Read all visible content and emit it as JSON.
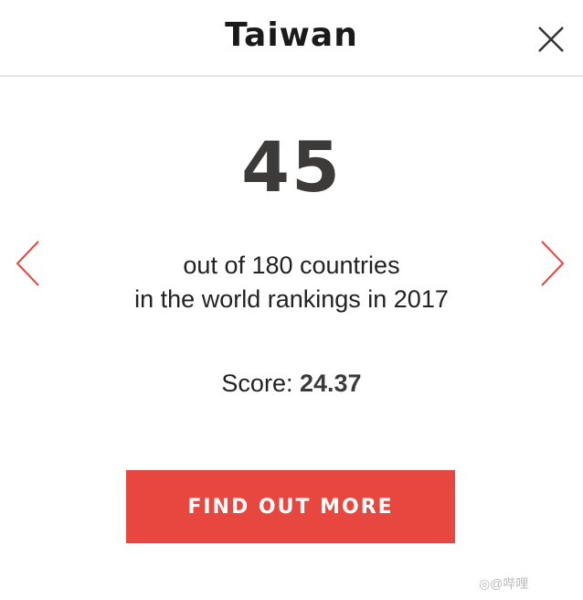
{
  "header": {
    "title": "Taiwan"
  },
  "ranking": {
    "position": "45",
    "line1": "out of 180 countries",
    "line2": "in the world rankings in 2017",
    "score_label": "Score:",
    "score_value": "24.37"
  },
  "cta": {
    "label": "FIND OUT MORE"
  },
  "watermark": {
    "text": "◎@哔哩"
  },
  "colors": {
    "accent": "#e8473f",
    "text": "#3d3a3a",
    "divider": "#e5e5e5"
  },
  "icons": {
    "close": "close-icon",
    "prev": "chevron-left-icon",
    "next": "chevron-right-icon"
  }
}
